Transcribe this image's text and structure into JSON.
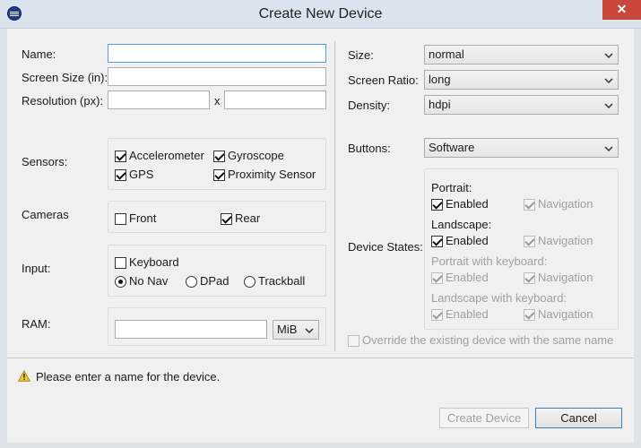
{
  "window": {
    "title": "Create New Device",
    "close_glyph": "✕",
    "app_icon": "eclipse-icon"
  },
  "left": {
    "name_label": "Name:",
    "name_value": "",
    "screen_size_label": "Screen Size (in):",
    "screen_size_value": "",
    "resolution_label": "Resolution (px):",
    "resolution_x_value": "",
    "resolution_y_value": "",
    "resolution_sep": "x",
    "sensors_label": "Sensors:",
    "sensors": [
      {
        "label": "Accelerometer",
        "checked": true
      },
      {
        "label": "Gyroscope",
        "checked": true
      },
      {
        "label": "GPS",
        "checked": true
      },
      {
        "label": "Proximity Sensor",
        "checked": true
      }
    ],
    "cameras_label": "Cameras",
    "cameras": [
      {
        "label": "Front",
        "checked": false
      },
      {
        "label": "Rear",
        "checked": true
      }
    ],
    "input_label": "Input:",
    "keyboard": {
      "label": "Keyboard",
      "checked": false
    },
    "nav_options": [
      {
        "label": "No Nav",
        "selected": true
      },
      {
        "label": "DPad",
        "selected": false
      },
      {
        "label": "Trackball",
        "selected": false
      }
    ],
    "ram_label": "RAM:",
    "ram_value": "",
    "ram_unit": "MiB"
  },
  "right": {
    "size_label": "Size:",
    "size_value": "normal",
    "ratio_label": "Screen Ratio:",
    "ratio_value": "long",
    "density_label": "Density:",
    "density_value": "hdpi",
    "buttons_label": "Buttons:",
    "buttons_value": "Software",
    "device_states_label": "Device States:",
    "states": [
      {
        "title": "Portrait:",
        "enabled": true,
        "enabled_label": "Enabled",
        "navigation_label": "Navigation",
        "title_disabled": false,
        "enabled_disabled": false
      },
      {
        "title": "Landscape:",
        "enabled": true,
        "enabled_label": "Enabled",
        "navigation_label": "Navigation",
        "title_disabled": false,
        "enabled_disabled": false
      },
      {
        "title": "Portrait with keyboard:",
        "enabled": true,
        "enabled_label": "Enabled",
        "navigation_label": "Navigation",
        "title_disabled": true,
        "enabled_disabled": true
      },
      {
        "title": "Landscape with keyboard:",
        "enabled": true,
        "enabled_label": "Enabled",
        "navigation_label": "Navigation",
        "title_disabled": true,
        "enabled_disabled": true
      }
    ],
    "override_label": "Override the existing device with the same name"
  },
  "status": {
    "icon": "warning-icon",
    "message": "Please enter a name for the device."
  },
  "footer": {
    "create_label": "Create Device",
    "cancel_label": "Cancel"
  }
}
